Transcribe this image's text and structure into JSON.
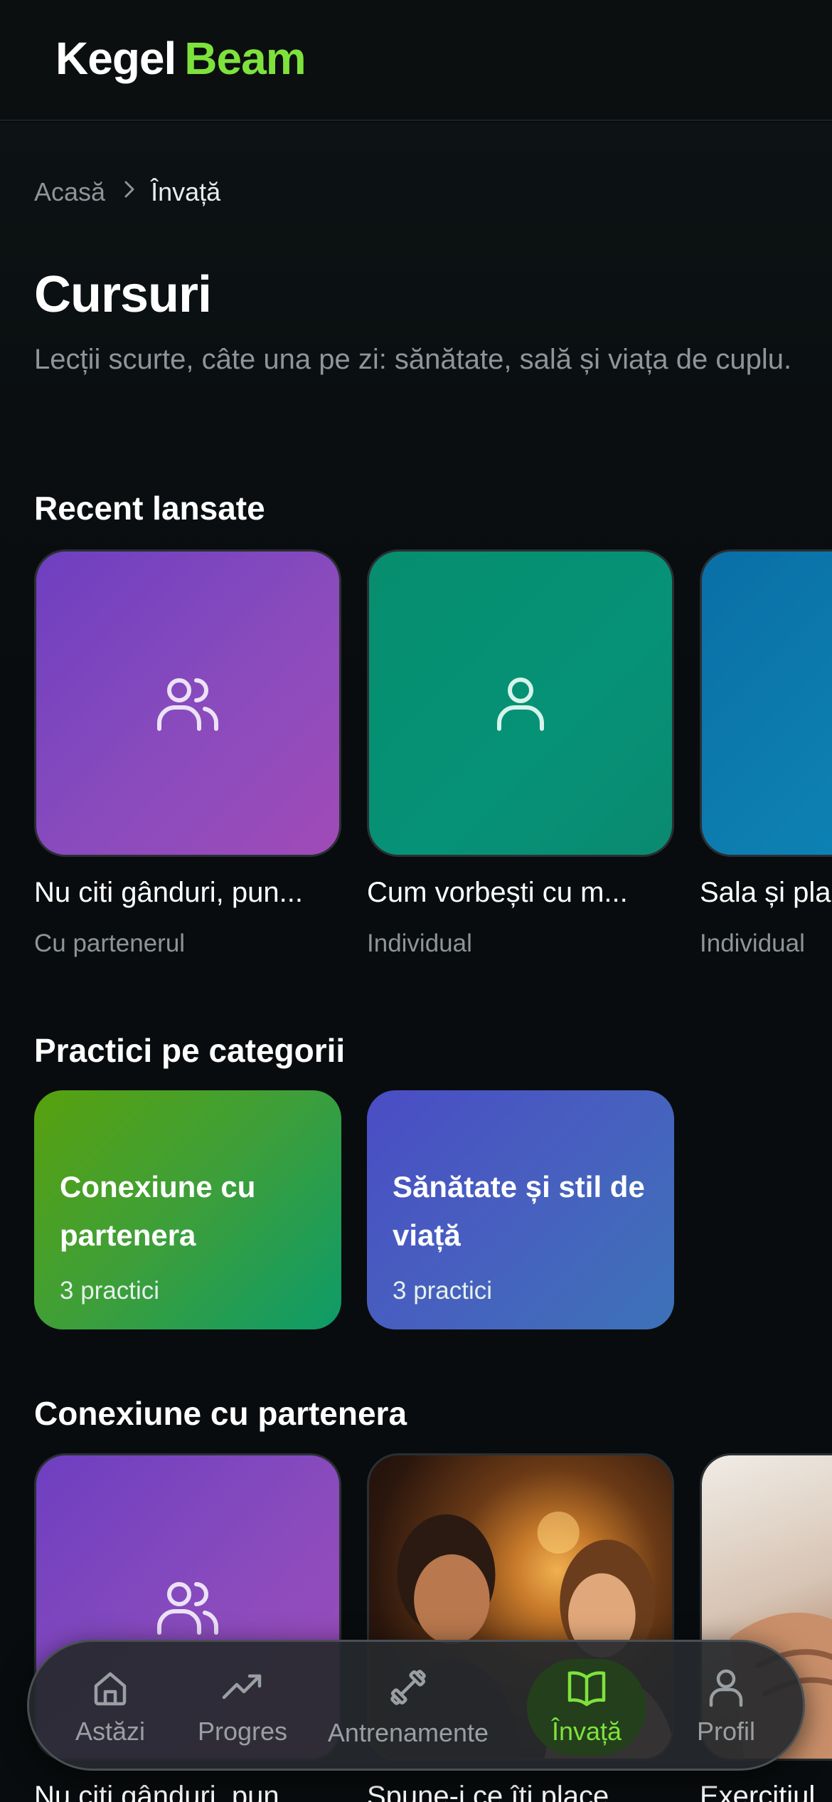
{
  "app": {
    "logo_part1": "Kegel",
    "logo_part2": "Beam"
  },
  "breadcrumb": {
    "home": "Acasă",
    "current": "Învață"
  },
  "header": {
    "title": "Cursuri",
    "subtitle": "Lecții scurte, câte una pe zi: sănătate, sală și viața de cuplu."
  },
  "recent": {
    "title": "Recent lansate",
    "items": [
      {
        "title": "Nu citi gânduri, pun...",
        "meta": "Cu partenerul",
        "icon": "users-icon"
      },
      {
        "title": "Cum vorbești cu m...",
        "meta": "Individual",
        "icon": "user-icon"
      },
      {
        "title": "Sala și pla",
        "meta": "Individual",
        "icon": "user-icon"
      }
    ]
  },
  "categories": {
    "title": "Practici pe categorii",
    "items": [
      {
        "name": "Conexiune cu partenera",
        "count": "3 practici"
      },
      {
        "name": "Sănătate și stil de viață",
        "count": "3 practici"
      }
    ]
  },
  "partner": {
    "title": "Conexiune cu partenera",
    "items": [
      {
        "title": "Nu citi gânduri, pun",
        "icon": "users-icon"
      },
      {
        "title": "Spune-i ce îți place"
      },
      {
        "title": "Exercițiul"
      }
    ]
  },
  "nav": {
    "items": [
      {
        "label": "Astăzi",
        "icon": "home-icon"
      },
      {
        "label": "Progres",
        "icon": "trend-icon"
      },
      {
        "label": "Antrenamente",
        "icon": "dumbbell-icon"
      },
      {
        "label": "Învață",
        "icon": "book-icon",
        "active": true
      },
      {
        "label": "Profil",
        "icon": "profile-icon"
      }
    ]
  },
  "colors": {
    "accent": "#7ee23c",
    "background": "#090c0e"
  }
}
